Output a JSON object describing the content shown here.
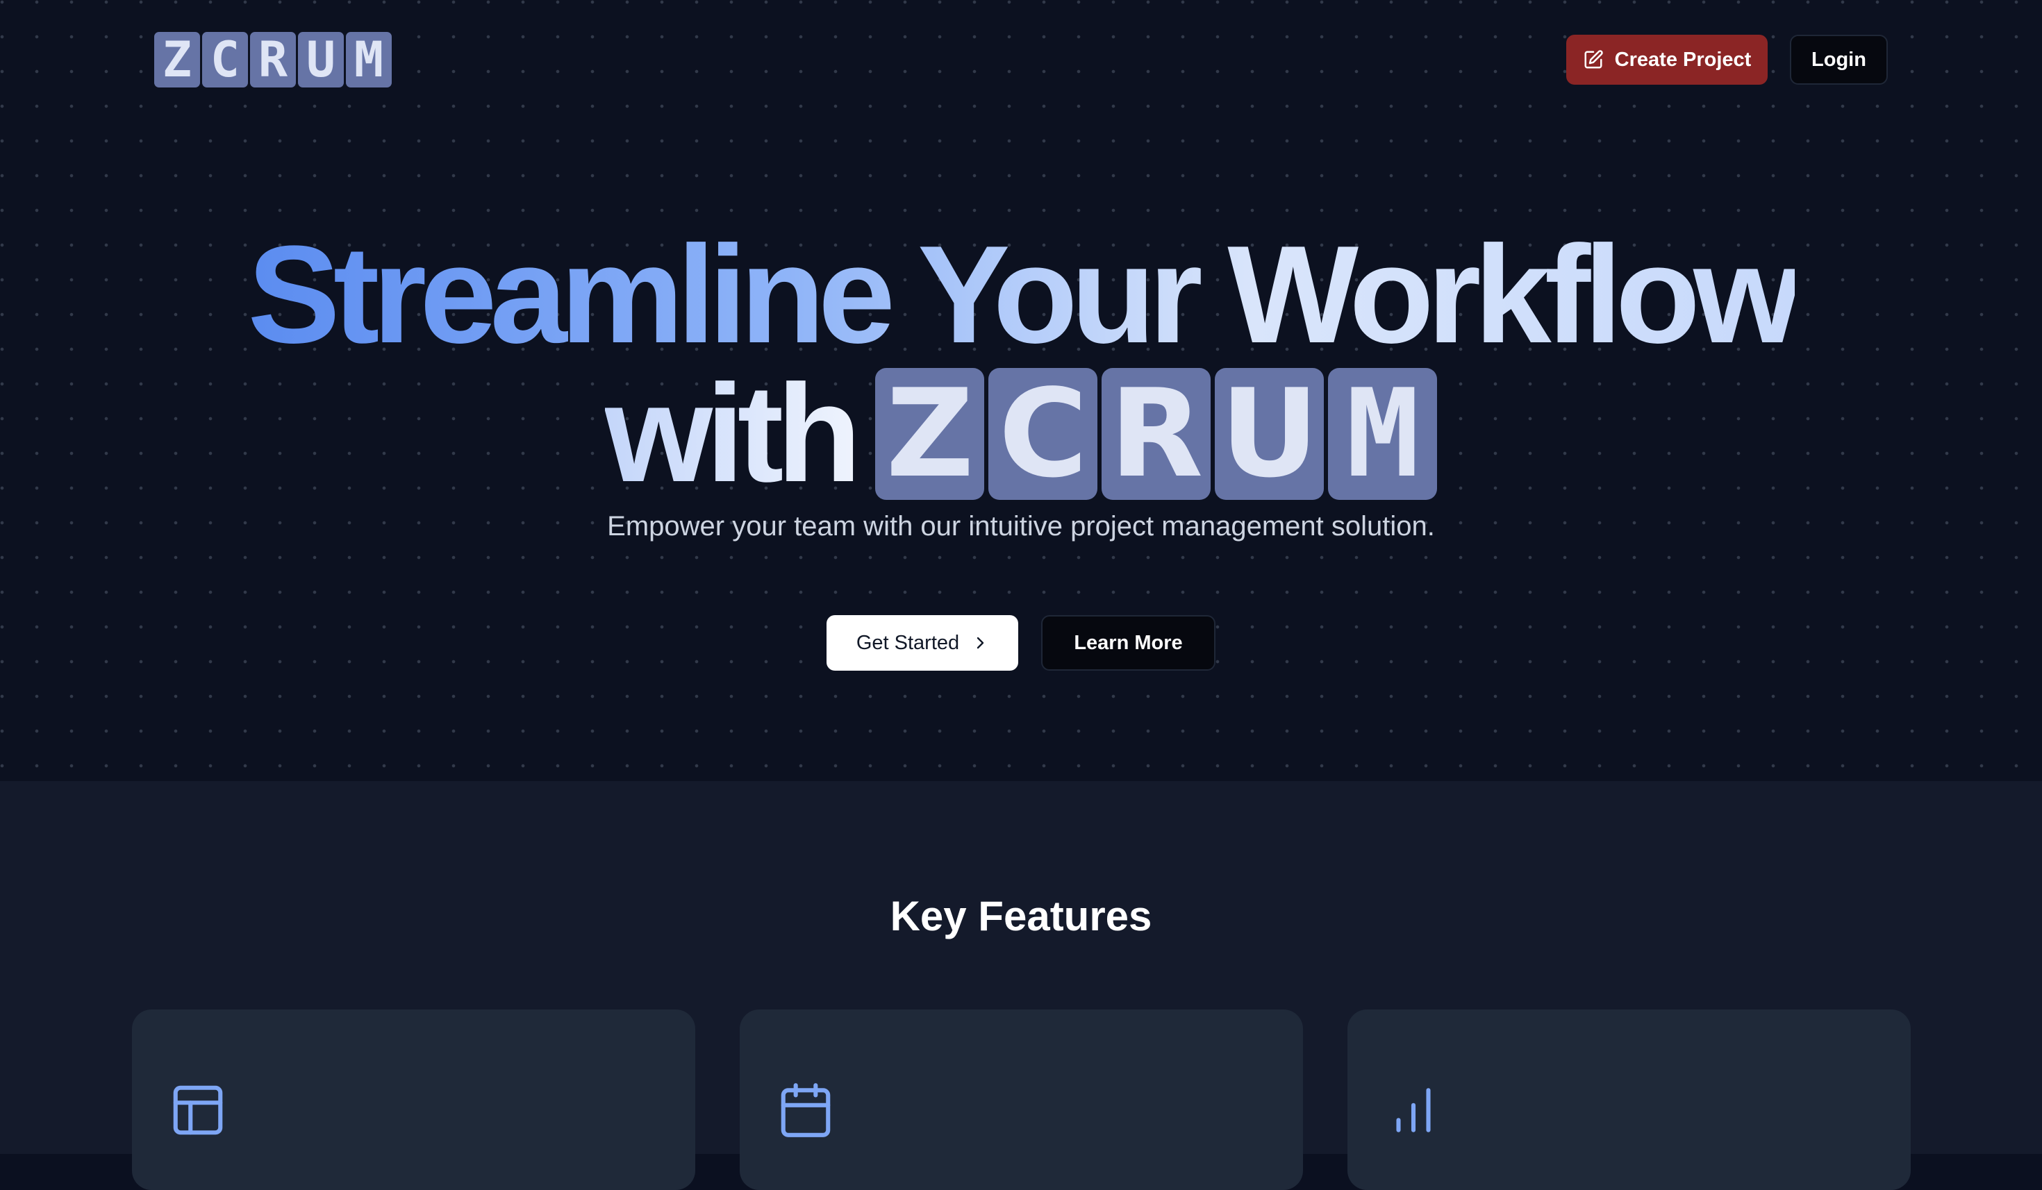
{
  "header": {
    "logo_letters": [
      "Z",
      "C",
      "R",
      "U",
      "M"
    ],
    "create_project_label": "Create Project",
    "login_label": "Login"
  },
  "hero": {
    "headline_line1": "Streamline Your Workflow",
    "headline_with": "with",
    "headline_logo_letters": [
      "Z",
      "C",
      "R",
      "U",
      "M"
    ],
    "subtitle": "Empower your team with our intuitive project management solution.",
    "get_started_label": "Get Started",
    "learn_more_label": "Learn More"
  },
  "features": {
    "title": "Key Features",
    "cards": [
      {
        "icon": "layout-icon"
      },
      {
        "icon": "calendar-icon"
      },
      {
        "icon": "bar-chart-icon"
      }
    ]
  },
  "colors": {
    "background": "#0c1120",
    "features_background": "#141a2b",
    "card_background": "#1f2939",
    "create_button": "#8b2525",
    "logo_tile": "#6674a6",
    "accent_blue": "#7ea6f5"
  }
}
